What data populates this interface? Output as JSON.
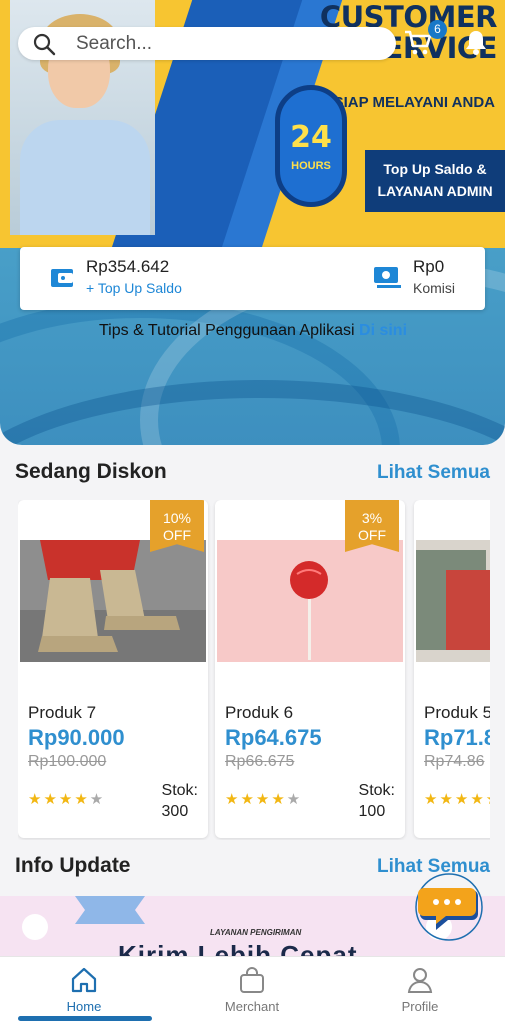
{
  "search": {
    "placeholder": "Search..."
  },
  "cart": {
    "badge": "6"
  },
  "banner": {
    "title_line1": "CUSTOMER",
    "title_line2": "SERVICE",
    "subtitle": "SIAP MELAYANI ANDA",
    "badge_number": "24",
    "badge_unit": "HOURS",
    "box_line1": "Top Up Saldo &",
    "box_line2": "LAYANAN ADMIN"
  },
  "balance": {
    "saldo_amount": "Rp354.642",
    "topup_link": "+ Top Up Saldo",
    "komisi_amount": "Rp0",
    "komisi_label": "Komisi"
  },
  "tips": {
    "text": "Tips & Tutorial Penggunaan Aplikasi",
    "link": "Di sini"
  },
  "discount_section": {
    "title": "Sedang Diskon",
    "see_all": "Lihat Semua"
  },
  "products": [
    {
      "name": "Produk 7",
      "price": "Rp90.000",
      "old_price": "Rp100.000",
      "discount_line1": "10%",
      "discount_line2": "OFF",
      "stok_label": "Stok:",
      "stok": "300",
      "rating": 4
    },
    {
      "name": "Produk 6",
      "price": "Rp64.675",
      "old_price": "Rp66.675",
      "discount_line1": "3%",
      "discount_line2": "OFF",
      "stok_label": "Stok:",
      "stok": "100",
      "rating": 4
    },
    {
      "name": "Produk 5",
      "price": "Rp71.8",
      "old_price": "Rp74.86",
      "rating": 5
    }
  ],
  "info_section": {
    "title": "Info Update",
    "see_all": "Lihat Semua"
  },
  "info_banner": {
    "label": "LAYANAN PENGIRIMAN",
    "headline": "Kirim Lebih Cepat"
  },
  "bottom_nav": [
    {
      "label": "Home",
      "icon": "home-icon",
      "active": true
    },
    {
      "label": "Merchant",
      "icon": "shopping-bag-icon",
      "active": false
    },
    {
      "label": "Profile",
      "icon": "user-icon",
      "active": false
    }
  ],
  "colors": {
    "accent": "#2f8fcf",
    "banner_yellow": "#f7c531",
    "banner_blue": "#1b5fb8",
    "star": "#f2b713",
    "ribbon": "#e5a12b"
  }
}
